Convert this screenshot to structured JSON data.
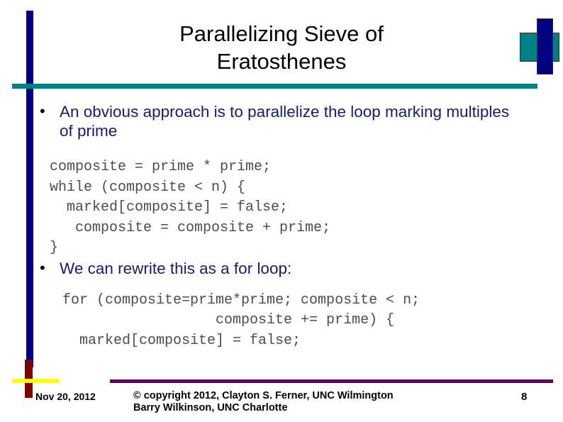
{
  "slide": {
    "title_lines": [
      "Parallelizing Sieve of",
      "Eratosthenes"
    ],
    "bullet_marker": "•",
    "bullets": [
      {
        "text": "An obvious approach is to parallelize the loop marking multiples of prime"
      },
      {
        "text": "We can rewrite this as a for loop:"
      }
    ],
    "code_blocks": [
      {
        "lines": [
          "composite = prime * prime;",
          "while (composite < n) {",
          "  marked[composite] = false;",
          "   composite = composite + prime;",
          "}"
        ]
      },
      {
        "lines": [
          "for (composite=prime*prime; composite < n;",
          "                  composite += prime) {",
          "  marked[composite] = false;"
        ]
      }
    ]
  },
  "footer": {
    "date": "Nov 20, 2012",
    "copyright_lines": [
      "© copyright 2012, Clayton S. Ferner, UNC Wilmington",
      "Barry Wilkinson, UNC Charlotte"
    ],
    "page_number": "8"
  },
  "colors": {
    "navy": "#000080",
    "teal": "#008080",
    "bullet_text": "#1a1a6e",
    "code_text": "#4d4d4d",
    "dark_red": "#800000",
    "yellow": "#ffff00",
    "purple": "#660066",
    "title_text": "#000000"
  }
}
